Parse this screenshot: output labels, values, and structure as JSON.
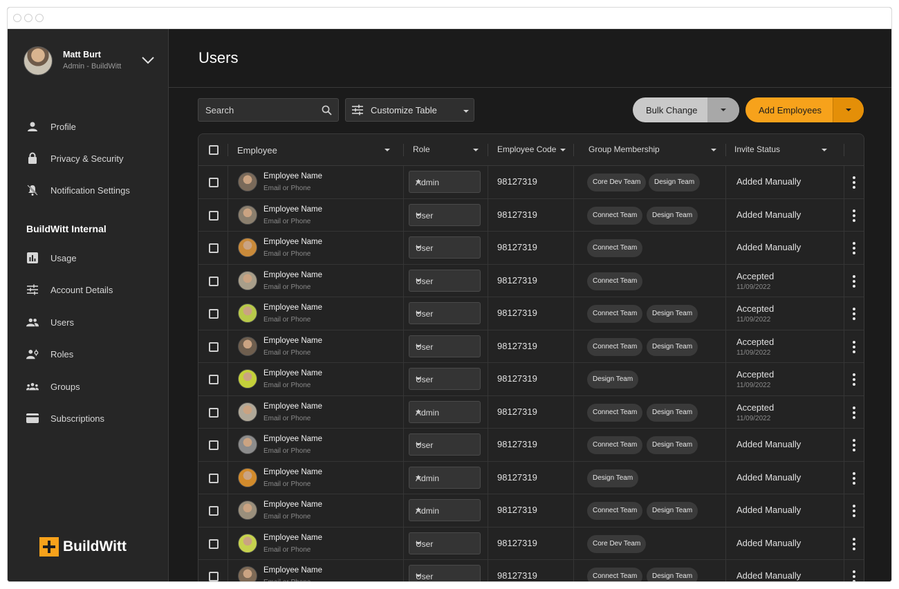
{
  "sidebar": {
    "user_name": "Matt Burt",
    "user_role": "Admin - BuildWitt",
    "nav_top": [
      {
        "label": "Profile",
        "icon": "person-icon"
      },
      {
        "label": "Privacy & Security",
        "icon": "lock-icon"
      },
      {
        "label": "Notification Settings",
        "icon": "notification-off-icon"
      }
    ],
    "section_title": "BuildWitt Internal",
    "nav_section": [
      {
        "label": "Usage",
        "icon": "bar-chart-icon"
      },
      {
        "label": "Account Details",
        "icon": "tune-icon"
      },
      {
        "label": "Users",
        "icon": "people-icon"
      },
      {
        "label": "Roles",
        "icon": "roles-icon"
      },
      {
        "label": "Groups",
        "icon": "groups-icon"
      },
      {
        "label": "Subscriptions",
        "icon": "credit-card-icon"
      }
    ],
    "brand": "BuildWitt"
  },
  "main": {
    "title": "Users",
    "search_placeholder": "Search",
    "customize_label": "Customize Table",
    "bulk_label": "Bulk Change",
    "add_label": "Add Employees"
  },
  "table": {
    "headers": {
      "employee": "Employee",
      "role": "Role",
      "code": "Employee Code",
      "group": "Group Membership",
      "status": "Invite Status"
    },
    "rows": [
      {
        "name": "Employee Name",
        "sub": "Email or Phone",
        "role": "Admin",
        "code": "98127319",
        "groups": [
          "Core Dev Team",
          "Design Team"
        ],
        "status": "Added Manually",
        "date": ""
      },
      {
        "name": "Employee Name",
        "sub": "Email or Phone",
        "role": "User",
        "code": "98127319",
        "groups": [
          "Connect Team",
          "Design Team"
        ],
        "status": "Added Manually",
        "date": ""
      },
      {
        "name": "Employee Name",
        "sub": "Email or Phone",
        "role": "User",
        "code": "98127319",
        "groups": [
          "Connect Team"
        ],
        "status": "Added Manually",
        "date": ""
      },
      {
        "name": "Employee Name",
        "sub": "Email or Phone",
        "role": "User",
        "code": "98127319",
        "groups": [
          "Connect Team"
        ],
        "status": "Accepted",
        "date": "11/09/2022"
      },
      {
        "name": "Employee Name",
        "sub": "Email or Phone",
        "role": "User",
        "code": "98127319",
        "groups": [
          "Connect Team",
          "Design Team"
        ],
        "status": "Accepted",
        "date": "11/09/2022"
      },
      {
        "name": "Employee Name",
        "sub": "Email or Phone",
        "role": "User",
        "code": "98127319",
        "groups": [
          "Connect Team",
          "Design Team"
        ],
        "status": "Accepted",
        "date": "11/09/2022"
      },
      {
        "name": "Employee Name",
        "sub": "Email or Phone",
        "role": "User",
        "code": "98127319",
        "groups": [
          "Design Team"
        ],
        "status": "Accepted",
        "date": "11/09/2022"
      },
      {
        "name": "Employee Name",
        "sub": "Email or Phone",
        "role": "Admin",
        "code": "98127319",
        "groups": [
          "Connect Team",
          "Design Team"
        ],
        "status": "Accepted",
        "date": "11/09/2022"
      },
      {
        "name": "Employee Name",
        "sub": "Email or Phone",
        "role": "User",
        "code": "98127319",
        "groups": [
          "Connect Team",
          "Design Team"
        ],
        "status": "Added Manually",
        "date": ""
      },
      {
        "name": "Employee Name",
        "sub": "Email or Phone",
        "role": "Admin",
        "code": "98127319",
        "groups": [
          "Design Team"
        ],
        "status": "Added Manually",
        "date": ""
      },
      {
        "name": "Employee Name",
        "sub": "Email or Phone",
        "role": "Admin",
        "code": "98127319",
        "groups": [
          "Connect Team",
          "Design Team"
        ],
        "status": "Added Manually",
        "date": ""
      },
      {
        "name": "Employee Name",
        "sub": "Email or Phone",
        "role": "User",
        "code": "98127319",
        "groups": [
          "Core Dev Team"
        ],
        "status": "Added Manually",
        "date": ""
      },
      {
        "name": "Employee Name",
        "sub": "Email or Phone",
        "role": "User",
        "code": "98127319",
        "groups": [
          "Connect Team",
          "Design Team"
        ],
        "status": "Added Manually",
        "date": ""
      }
    ]
  },
  "colors": {
    "accent": "#f7a21b",
    "sidebar_bg": "#262626",
    "main_bg": "#1b1b1b",
    "chip_bg": "#3a3a3a"
  }
}
